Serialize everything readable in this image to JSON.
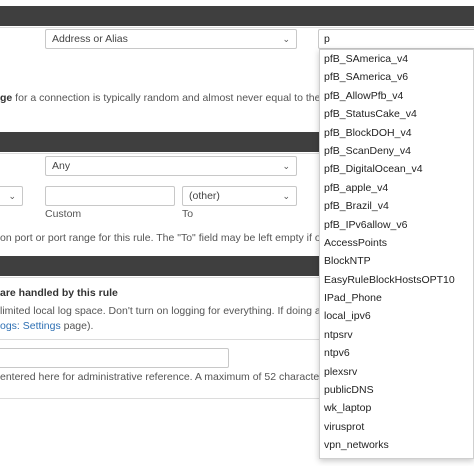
{
  "source_panel": {
    "type_select": "Address or Alias",
    "address_value": "p",
    "help_text_bold": "ge",
    "help_text_rest": " for a connection is typically random and almost never equal to the des"
  },
  "dest_panel": {
    "type_select": "Any",
    "from_caret": "▾",
    "custom_value": "",
    "to_select": "(other)",
    "custom_label": "Custom",
    "to_label": "To",
    "help_text": "on port or port range for this rule. The \"To\" field may be left empty if only f"
  },
  "extra_panel": {
    "log_label": "are handled by this rule",
    "log_help_1": "limited local log space. Don't turn on logging for everything. If doing a lot",
    "log_help_2_link": "ogs: Settings",
    "log_help_2_rest": " page).",
    "description_value": "",
    "description_help": "entered here for administrative reference. A maximum of 52 characters"
  },
  "dropdown": {
    "items": [
      "pfB_SAmerica_v4",
      "pfB_SAmerica_v6",
      "pfB_AllowPfb_v4",
      "pfB_StatusCake_v4",
      "pfB_BlockDOH_v4",
      "pfB_ScanDeny_v4",
      "pfB_DigitalOcean_v4",
      "pfB_apple_v4",
      "pfB_Brazil_v4",
      "pfB_IPv6allow_v6",
      "AccessPoints",
      "BlockNTP",
      "EasyRuleBlockHostsOPT10",
      "IPad_Phone",
      "local_ipv6",
      "ntpsrv",
      "ntpv6",
      "plexsrv",
      "publicDNS",
      "wk_laptop",
      "virusprot",
      "vpn_networks"
    ]
  },
  "colors": {
    "panel_header": "#3f3f3f",
    "link": "#2d6fb3"
  }
}
